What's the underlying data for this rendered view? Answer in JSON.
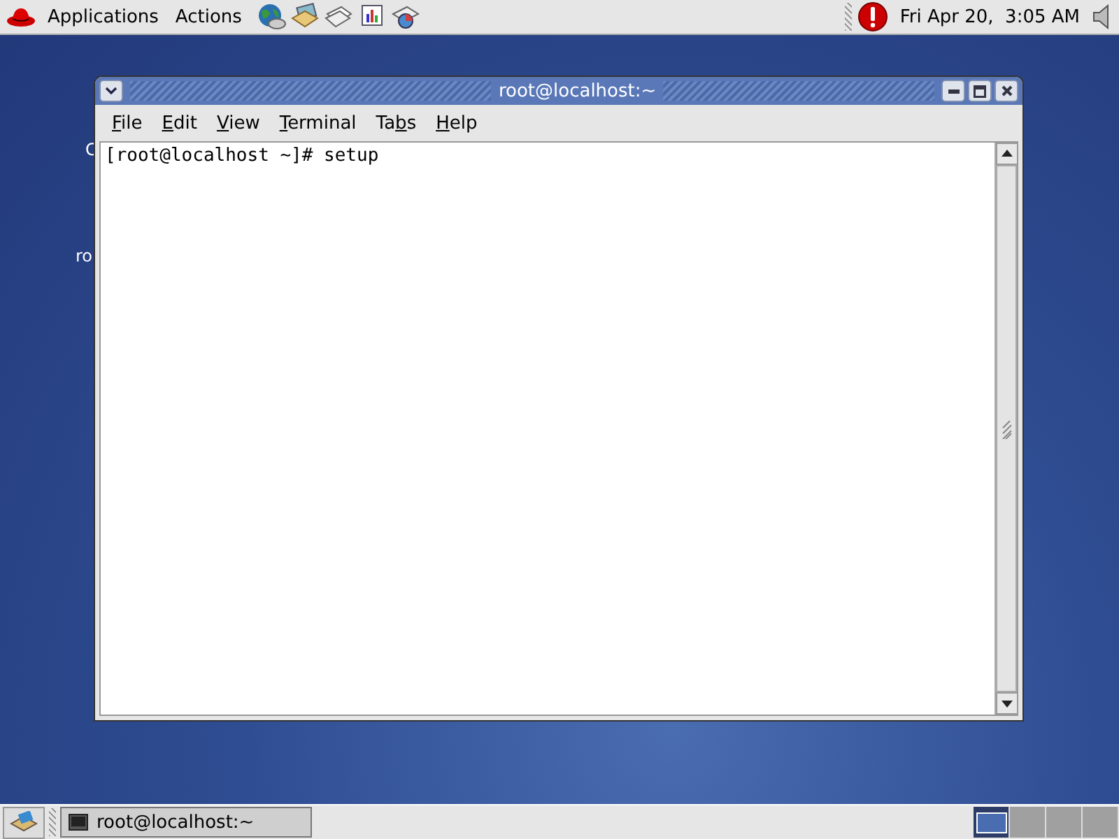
{
  "top_panel": {
    "menus": [
      "Applications",
      "Actions"
    ],
    "clock": "Fri Apr 20,  3:05 AM"
  },
  "desktop": {
    "icon_labels": [
      "C",
      "ro"
    ]
  },
  "window": {
    "title": "root@localhost:~",
    "menu": [
      {
        "key": "F",
        "post": "ile"
      },
      {
        "key": "E",
        "post": "dit"
      },
      {
        "key": "V",
        "post": "iew"
      },
      {
        "key": "T",
        "post": "erminal"
      },
      {
        "pre": "Ta",
        "key": "b",
        "post": "s"
      },
      {
        "key": "H",
        "post": "elp"
      }
    ],
    "terminal_lines": [
      "[root@localhost ~]# setup"
    ]
  },
  "bottom_panel": {
    "tasks": [
      {
        "label": "root@localhost:~",
        "selected": false
      }
    ],
    "workspaces": [
      {
        "selected": true
      },
      {
        "selected": false
      },
      {
        "selected": false
      },
      {
        "selected": false
      }
    ]
  }
}
